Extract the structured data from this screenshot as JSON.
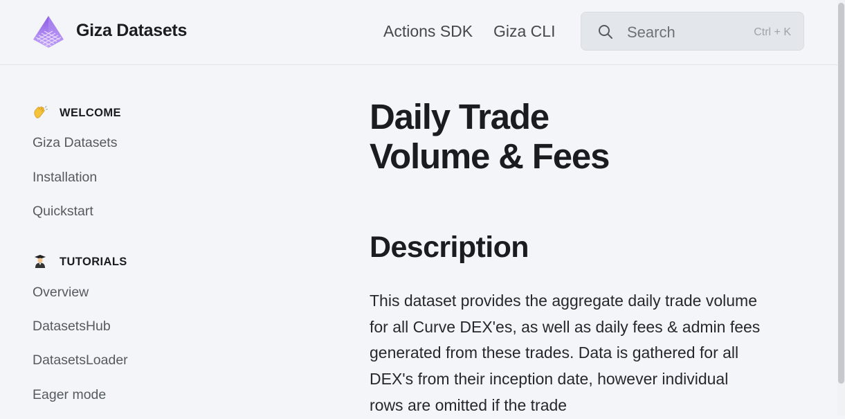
{
  "header": {
    "brand": "Giza Datasets",
    "logo_icon": "pyramid-logo-icon",
    "nav": [
      "Actions SDK",
      "Giza CLI"
    ],
    "search": {
      "placeholder": "Search",
      "shortcut": "Ctrl + K",
      "icon": "search-icon"
    }
  },
  "sidebar": {
    "sections": [
      {
        "title": "WELCOME",
        "icon": "waving-hand-icon",
        "items": [
          "Giza Datasets",
          "Installation",
          "Quickstart"
        ]
      },
      {
        "title": "TUTORIALS",
        "icon": "student-icon",
        "items": [
          "Overview",
          "DatasetsHub",
          "DatasetsLoader",
          "Eager mode"
        ]
      }
    ]
  },
  "main": {
    "title_line1": "Daily Trade",
    "title_line2": "Volume & Fees",
    "section_heading": "Description",
    "paragraph": "This dataset provides the aggregate daily trade volume for all Curve DEX'es, as well as daily fees & admin fees generated from these trades. Data is gathered for all DEX's from their inception date, however individual rows are omitted if the trade"
  },
  "colors": {
    "background": "#f3f5f8",
    "logo_purple": "#a57bf0",
    "text": "#1d1f23"
  }
}
